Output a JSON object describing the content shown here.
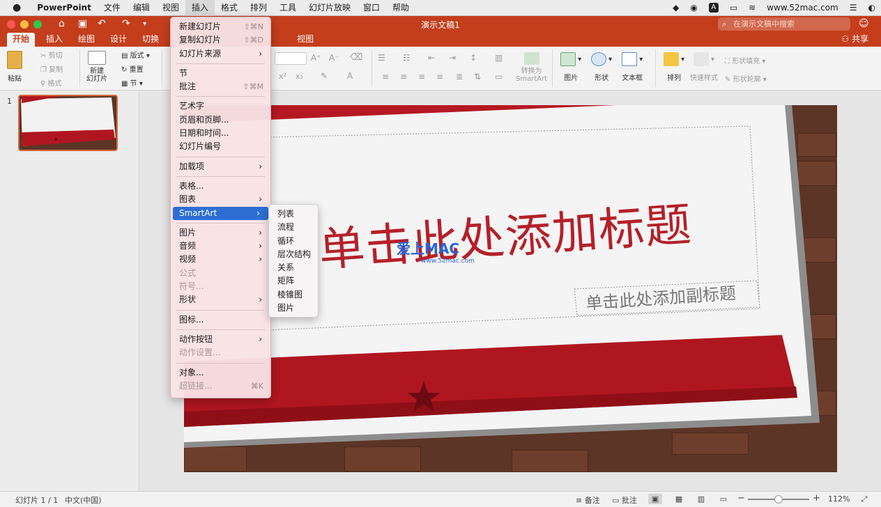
{
  "menubar": {
    "app": "PowerPoint",
    "items": [
      "文件",
      "编辑",
      "视图",
      "插入",
      "格式",
      "排列",
      "工具",
      "幻灯片放映",
      "窗口",
      "帮助"
    ],
    "active_index": 3,
    "url": "www.52mac.com"
  },
  "window": {
    "title": "演示文稿1",
    "search_placeholder": "在演示文稿中搜索",
    "share_label": "共享"
  },
  "tabs": [
    "开始",
    "插入",
    "绘图",
    "设计",
    "切换",
    "视图"
  ],
  "ribbon": {
    "paste": "粘贴",
    "cut": "剪切",
    "copy": "复制",
    "format": "格式",
    "new_slide": "新建\n幻灯片",
    "layout": "版式",
    "reset": "重置",
    "section": "节",
    "convert_smartart": "转换为\nSmartArt",
    "picture": "图片",
    "shape": "形状",
    "textbox": "文本框",
    "arrange": "排列",
    "quick_styles": "快速样式",
    "shape_fill": "形状填充",
    "shape_outline": "形状轮廓"
  },
  "thumbnails": {
    "number": "1"
  },
  "slide": {
    "title": "单击此处添加标题",
    "subtitle": "单击此处添加副标题",
    "watermark": "爱上MAC",
    "watermark_url": "www.52mac.com"
  },
  "insert_menu": {
    "groups": [
      [
        {
          "label": "新建幻灯片",
          "shortcut": "⇧⌘N",
          "arrow": false,
          "disabled": false
        },
        {
          "label": "复制幻灯片",
          "shortcut": "⇧⌘D",
          "arrow": false,
          "disabled": false
        },
        {
          "label": "幻灯片来源",
          "shortcut": "",
          "arrow": true,
          "disabled": false
        }
      ],
      [
        {
          "label": "节",
          "shortcut": "",
          "arrow": false,
          "disabled": false
        },
        {
          "label": "批注",
          "shortcut": "⇧⌘M",
          "arrow": false,
          "disabled": false
        }
      ],
      [
        {
          "label": "艺术字",
          "shortcut": "",
          "arrow": false,
          "disabled": false
        },
        {
          "label": "页眉和页脚...",
          "shortcut": "",
          "arrow": false,
          "disabled": false
        },
        {
          "label": "日期和时间...",
          "shortcut": "",
          "arrow": false,
          "disabled": false
        },
        {
          "label": "幻灯片编号",
          "shortcut": "",
          "arrow": false,
          "disabled": false
        }
      ],
      [
        {
          "label": "加载项",
          "shortcut": "",
          "arrow": true,
          "disabled": false
        }
      ],
      [
        {
          "label": "表格...",
          "shortcut": "",
          "arrow": false,
          "disabled": false
        },
        {
          "label": "图表",
          "shortcut": "",
          "arrow": true,
          "disabled": false
        },
        {
          "label": "SmartArt",
          "shortcut": "",
          "arrow": true,
          "disabled": false,
          "highlighted": true
        }
      ],
      [
        {
          "label": "图片",
          "shortcut": "",
          "arrow": true,
          "disabled": false
        },
        {
          "label": "音频",
          "shortcut": "",
          "arrow": true,
          "disabled": false
        },
        {
          "label": "视频",
          "shortcut": "",
          "arrow": true,
          "disabled": false
        },
        {
          "label": "公式",
          "shortcut": "",
          "arrow": false,
          "disabled": true
        },
        {
          "label": "符号...",
          "shortcut": "",
          "arrow": false,
          "disabled": true
        },
        {
          "label": "形状",
          "shortcut": "",
          "arrow": true,
          "disabled": false
        }
      ],
      [
        {
          "label": "图标...",
          "shortcut": "",
          "arrow": false,
          "disabled": false
        }
      ],
      [
        {
          "label": "动作按钮",
          "shortcut": "",
          "arrow": true,
          "disabled": false
        },
        {
          "label": "动作设置...",
          "shortcut": "",
          "arrow": false,
          "disabled": true
        }
      ],
      [
        {
          "label": "对象...",
          "shortcut": "",
          "arrow": false,
          "disabled": false
        },
        {
          "label": "超链接...",
          "shortcut": "⌘K",
          "arrow": false,
          "disabled": true
        }
      ]
    ]
  },
  "smartart_menu": [
    "列表",
    "流程",
    "循环",
    "层次结构",
    "关系",
    "矩阵",
    "棱锥图",
    "图片"
  ],
  "statusbar": {
    "slide_count": "幻灯片 1 / 1",
    "language": "中文(中国)",
    "notes": "备注",
    "comments": "批注",
    "zoom": "112%",
    "zoom_level": 0.5
  },
  "colors": {
    "accent": "#c43e1c",
    "menu_highlight": "#2c6ed4",
    "slide_red": "#b5202a"
  }
}
